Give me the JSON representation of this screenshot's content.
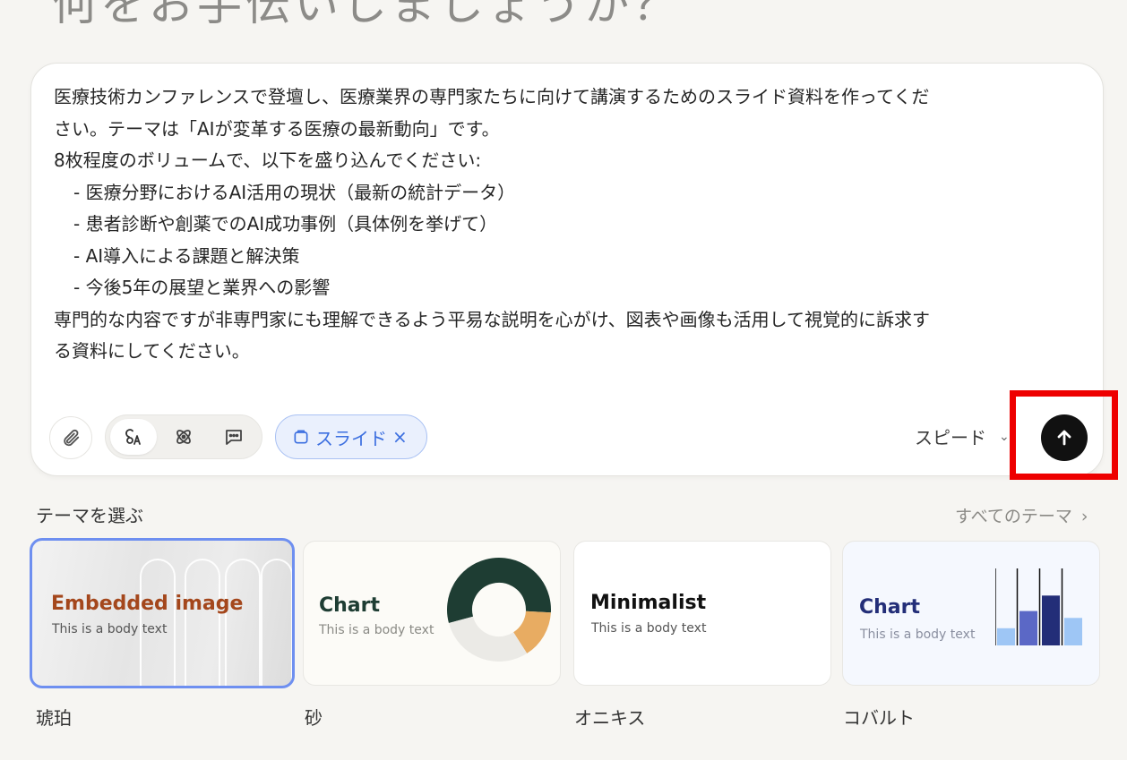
{
  "header": {
    "title": "何をお手伝いしましょうか？"
  },
  "composer": {
    "prompt_lines": [
      "医療技術カンファレンスで登壇し、医療業界の専門家たちに向けて講演するためのスライド資料を作ってくだ",
      "さい。テーマは「AIが変革する医療の最新動向」です。",
      "8枚程度のボリュームで、以下を盛り込んでください:",
      "- 医療分野におけるAI活用の現状（最新の統計データ）",
      "- 患者診断や創薬でのAI成功事例（具体例を挙げて）",
      "- AI導入による課題と解決策",
      "- 今後5年の展望と業界への影響",
      "専門的な内容ですが非専門家にも理解できるよう平易な説明を心がけ、図表や画像も活用して視覚的に訴求す",
      "る資料にしてください。"
    ],
    "slide_chip_label": "スライド",
    "slide_chip_close": "×",
    "speed_label": "スピード",
    "speed_chevron": "⌄"
  },
  "themes": {
    "heading": "テーマを選ぶ",
    "all_link": "すべてのテーマ",
    "all_link_chevron": "›",
    "cards": [
      {
        "name": "琥珀",
        "title": "Embedded image",
        "body": "This is a body text"
      },
      {
        "name": "砂",
        "title": "Chart",
        "body": "This is a body text"
      },
      {
        "name": "オニキス",
        "title": "Minimalist",
        "body": "This is a body text"
      },
      {
        "name": "コバルト",
        "title": "Chart",
        "body": "This is a body text"
      }
    ]
  },
  "colors": {
    "accent_blue": "#3c6fe0",
    "kohaku_title": "#a4471c",
    "suna_dark": "#1e3d33",
    "suna_accent": "#e8ac62",
    "cobalt_dark": "#232e78",
    "cobalt_mid": "#5b68c6",
    "cobalt_light": "#9ec6f5",
    "highlight_red": "#ee0000"
  },
  "chart_previews": {
    "suna_donut": {
      "values": [
        55,
        15,
        30
      ]
    },
    "cobalt_bars": {
      "values": [
        20,
        40,
        58,
        32
      ]
    }
  }
}
